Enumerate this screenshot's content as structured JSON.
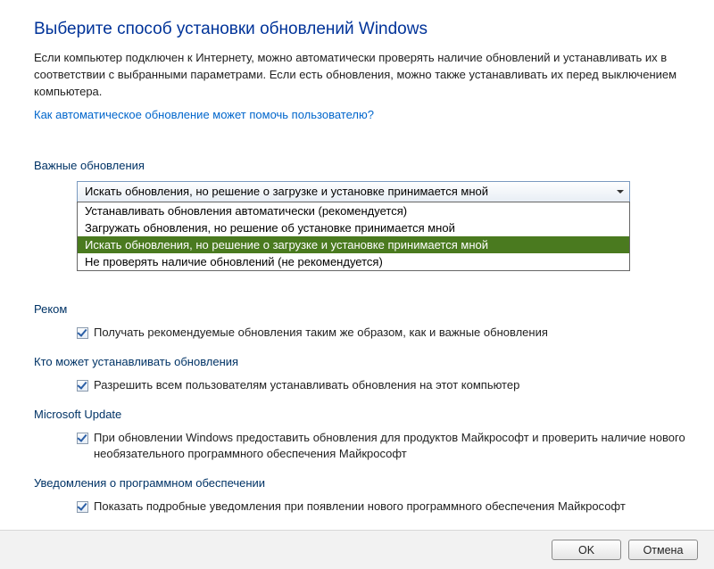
{
  "page_title": "Выберите способ установки обновлений Windows",
  "intro_text": "Если компьютер подключен к Интернету, можно автоматически проверять наличие обновлений и устанавливать их в соответствии с выбранными параметрами. Если есть обновления, можно также устанавливать их перед выключением компьютера.",
  "help_link": "Как автоматическое обновление может помочь пользователю?",
  "sections": {
    "important": {
      "title": "Важные обновления",
      "dropdown": {
        "selected": "Искать обновления, но решение о загрузке и установке принимается мной",
        "options": [
          "Устанавливать обновления автоматически (рекомендуется)",
          "Загружать обновления, но решение об установке принимается мной",
          "Искать обновления, но решение о загрузке и установке принимается мной",
          "Не проверять наличие обновлений (не рекомендуется)"
        ],
        "selected_index": 2
      }
    },
    "recommended": {
      "title_visible": "Реком",
      "checkbox_label": "Получать рекомендуемые обновления таким же образом, как и важные обновления",
      "checked": true
    },
    "who_can_install": {
      "title": "Кто может устанавливать обновления",
      "checkbox_label": "Разрешить всем пользователям устанавливать обновления на этот компьютер",
      "checked": true
    },
    "microsoft_update": {
      "title": "Microsoft Update",
      "checkbox_label": "При обновлении Windows предоставить обновления для продуктов Майкрософт и проверить наличие нового необязательного программного обеспечения Майкрософт",
      "checked": true
    },
    "notifications": {
      "title": "Уведомления о программном обеспечении",
      "checkbox_label": "Показать подробные уведомления при появлении нового программного обеспечения Майкрософт",
      "checked": true
    }
  },
  "footer": {
    "ok": "OK",
    "cancel": "Отмена"
  }
}
